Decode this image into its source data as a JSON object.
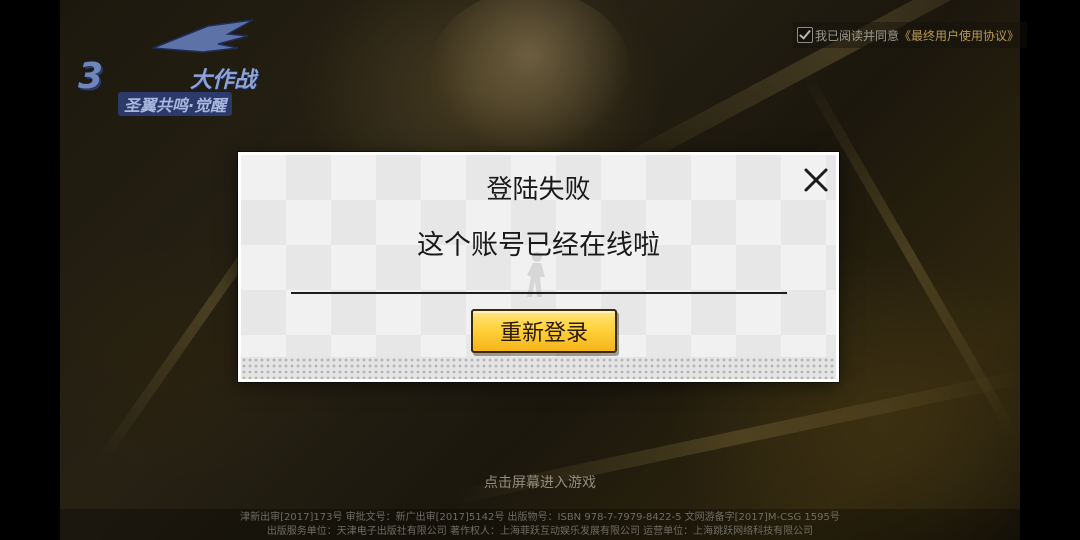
{
  "logo": {
    "mark": "3",
    "main": "大作战",
    "sub": "圣翼共鸣·觉醒"
  },
  "agreement": {
    "prefix": "我已阅读并同意",
    "link": "《最终用户使用协议》",
    "checked": true
  },
  "dialog": {
    "title": "登陆失败",
    "message": "这个账号已经在线啦",
    "relogin_label": "重新登录"
  },
  "tap_to_start": "点击屏幕进入游戏",
  "footer": {
    "line1": "津新出审[2017]173号 审批文号：新广出审[2017]5142号 出版物号：ISBN 978-7-7979-8422-5 文网游备字[2017]M-CSG 1595号",
    "line2": "出版服务单位：天津电子出版社有限公司 著作权人：上海菲跃互动娱乐发展有限公司 运营单位：上海跳跃网络科技有限公司"
  },
  "colors": {
    "button_yellow": "#ffd23c",
    "dialog_bg": "#f1f1f1",
    "logo_blue": "#6f86b8",
    "agreement_link": "#b99a55"
  },
  "icons": {
    "close": "close-icon",
    "checkbox": "checkbox-checked-icon"
  }
}
